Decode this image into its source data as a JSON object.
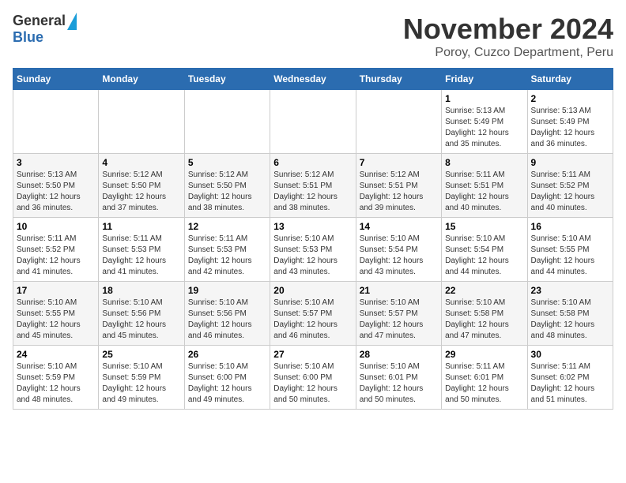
{
  "header": {
    "logo": {
      "general": "General",
      "blue": "Blue"
    },
    "title": "November 2024",
    "location": "Poroy, Cuzco Department, Peru"
  },
  "calendar": {
    "headers": [
      "Sunday",
      "Monday",
      "Tuesday",
      "Wednesday",
      "Thursday",
      "Friday",
      "Saturday"
    ],
    "weeks": [
      [
        {
          "day": "",
          "info": ""
        },
        {
          "day": "",
          "info": ""
        },
        {
          "day": "",
          "info": ""
        },
        {
          "day": "",
          "info": ""
        },
        {
          "day": "",
          "info": ""
        },
        {
          "day": "1",
          "info": "Sunrise: 5:13 AM\nSunset: 5:49 PM\nDaylight: 12 hours\nand 35 minutes."
        },
        {
          "day": "2",
          "info": "Sunrise: 5:13 AM\nSunset: 5:49 PM\nDaylight: 12 hours\nand 36 minutes."
        }
      ],
      [
        {
          "day": "3",
          "info": "Sunrise: 5:13 AM\nSunset: 5:50 PM\nDaylight: 12 hours\nand 36 minutes."
        },
        {
          "day": "4",
          "info": "Sunrise: 5:12 AM\nSunset: 5:50 PM\nDaylight: 12 hours\nand 37 minutes."
        },
        {
          "day": "5",
          "info": "Sunrise: 5:12 AM\nSunset: 5:50 PM\nDaylight: 12 hours\nand 38 minutes."
        },
        {
          "day": "6",
          "info": "Sunrise: 5:12 AM\nSunset: 5:51 PM\nDaylight: 12 hours\nand 38 minutes."
        },
        {
          "day": "7",
          "info": "Sunrise: 5:12 AM\nSunset: 5:51 PM\nDaylight: 12 hours\nand 39 minutes."
        },
        {
          "day": "8",
          "info": "Sunrise: 5:11 AM\nSunset: 5:51 PM\nDaylight: 12 hours\nand 40 minutes."
        },
        {
          "day": "9",
          "info": "Sunrise: 5:11 AM\nSunset: 5:52 PM\nDaylight: 12 hours\nand 40 minutes."
        }
      ],
      [
        {
          "day": "10",
          "info": "Sunrise: 5:11 AM\nSunset: 5:52 PM\nDaylight: 12 hours\nand 41 minutes."
        },
        {
          "day": "11",
          "info": "Sunrise: 5:11 AM\nSunset: 5:53 PM\nDaylight: 12 hours\nand 41 minutes."
        },
        {
          "day": "12",
          "info": "Sunrise: 5:11 AM\nSunset: 5:53 PM\nDaylight: 12 hours\nand 42 minutes."
        },
        {
          "day": "13",
          "info": "Sunrise: 5:10 AM\nSunset: 5:53 PM\nDaylight: 12 hours\nand 43 minutes."
        },
        {
          "day": "14",
          "info": "Sunrise: 5:10 AM\nSunset: 5:54 PM\nDaylight: 12 hours\nand 43 minutes."
        },
        {
          "day": "15",
          "info": "Sunrise: 5:10 AM\nSunset: 5:54 PM\nDaylight: 12 hours\nand 44 minutes."
        },
        {
          "day": "16",
          "info": "Sunrise: 5:10 AM\nSunset: 5:55 PM\nDaylight: 12 hours\nand 44 minutes."
        }
      ],
      [
        {
          "day": "17",
          "info": "Sunrise: 5:10 AM\nSunset: 5:55 PM\nDaylight: 12 hours\nand 45 minutes."
        },
        {
          "day": "18",
          "info": "Sunrise: 5:10 AM\nSunset: 5:56 PM\nDaylight: 12 hours\nand 45 minutes."
        },
        {
          "day": "19",
          "info": "Sunrise: 5:10 AM\nSunset: 5:56 PM\nDaylight: 12 hours\nand 46 minutes."
        },
        {
          "day": "20",
          "info": "Sunrise: 5:10 AM\nSunset: 5:57 PM\nDaylight: 12 hours\nand 46 minutes."
        },
        {
          "day": "21",
          "info": "Sunrise: 5:10 AM\nSunset: 5:57 PM\nDaylight: 12 hours\nand 47 minutes."
        },
        {
          "day": "22",
          "info": "Sunrise: 5:10 AM\nSunset: 5:58 PM\nDaylight: 12 hours\nand 47 minutes."
        },
        {
          "day": "23",
          "info": "Sunrise: 5:10 AM\nSunset: 5:58 PM\nDaylight: 12 hours\nand 48 minutes."
        }
      ],
      [
        {
          "day": "24",
          "info": "Sunrise: 5:10 AM\nSunset: 5:59 PM\nDaylight: 12 hours\nand 48 minutes."
        },
        {
          "day": "25",
          "info": "Sunrise: 5:10 AM\nSunset: 5:59 PM\nDaylight: 12 hours\nand 49 minutes."
        },
        {
          "day": "26",
          "info": "Sunrise: 5:10 AM\nSunset: 6:00 PM\nDaylight: 12 hours\nand 49 minutes."
        },
        {
          "day": "27",
          "info": "Sunrise: 5:10 AM\nSunset: 6:00 PM\nDaylight: 12 hours\nand 50 minutes."
        },
        {
          "day": "28",
          "info": "Sunrise: 5:10 AM\nSunset: 6:01 PM\nDaylight: 12 hours\nand 50 minutes."
        },
        {
          "day": "29",
          "info": "Sunrise: 5:11 AM\nSunset: 6:01 PM\nDaylight: 12 hours\nand 50 minutes."
        },
        {
          "day": "30",
          "info": "Sunrise: 5:11 AM\nSunset: 6:02 PM\nDaylight: 12 hours\nand 51 minutes."
        }
      ]
    ]
  }
}
